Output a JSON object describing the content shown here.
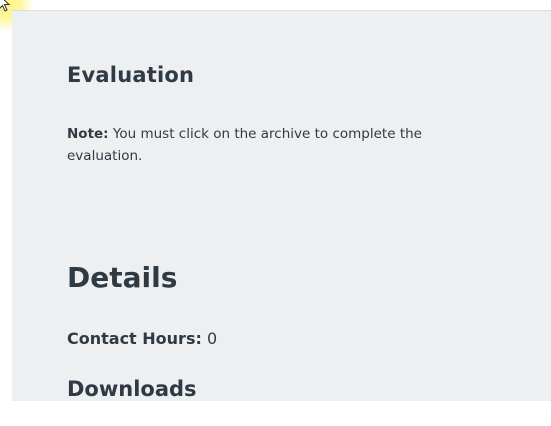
{
  "evaluation": {
    "heading": "Evaluation",
    "note_label": "Note:",
    "note_text": "You must click on the archive to complete the evaluation."
  },
  "details": {
    "heading": "Details",
    "contact_hours_label": "Contact Hours:",
    "contact_hours_value": "0"
  },
  "downloads": {
    "heading": "Downloads"
  },
  "colors": {
    "panel_bg": "#eeeff1",
    "text": "#2f3a44",
    "cursor_highlight": "#fff27a"
  }
}
